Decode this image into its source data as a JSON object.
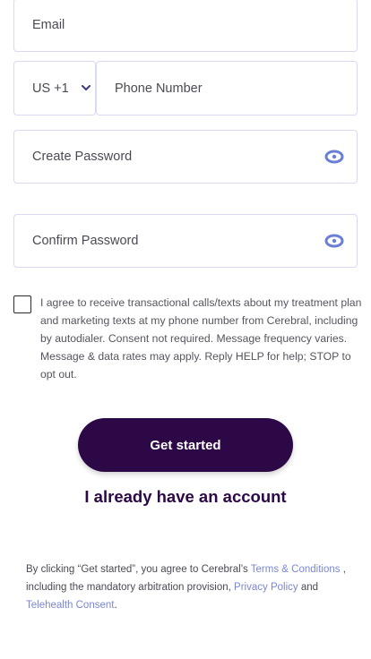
{
  "form": {
    "email_placeholder": "Email",
    "country_code": "US +1",
    "phone_placeholder": "Phone Number",
    "password_placeholder": "Create Password",
    "confirm_placeholder": "Confirm Password",
    "consent_text": "I agree to receive transactional calls/texts about my treatment plan and marketing texts at my phone number from Cerebral, including by autodialer. Consent not required. Message frequency varies. Message & data rates may apply. Reply HELP for help; STOP to opt out.",
    "consent_checked": false,
    "submit_label": "Get started",
    "login_label": "I already have an account"
  },
  "legal": {
    "prefix": "By clicking “Get started”, you agree to Cerebral’s ",
    "terms_link": "Terms & Conditions",
    "middle": " , including the mandatory arbitration provision, ",
    "privacy_link": "Privacy Policy",
    "and": " and ",
    "telehealth_link": "Telehealth Consent",
    "suffix": "."
  },
  "icons": {
    "chevron": "chevron-down-icon",
    "eye": "eye-icon"
  },
  "colors": {
    "primary": "#2d0847",
    "link": "#7b87d3",
    "eye_icon": "#6a7fd6",
    "field_border": "#d8daf2"
  }
}
